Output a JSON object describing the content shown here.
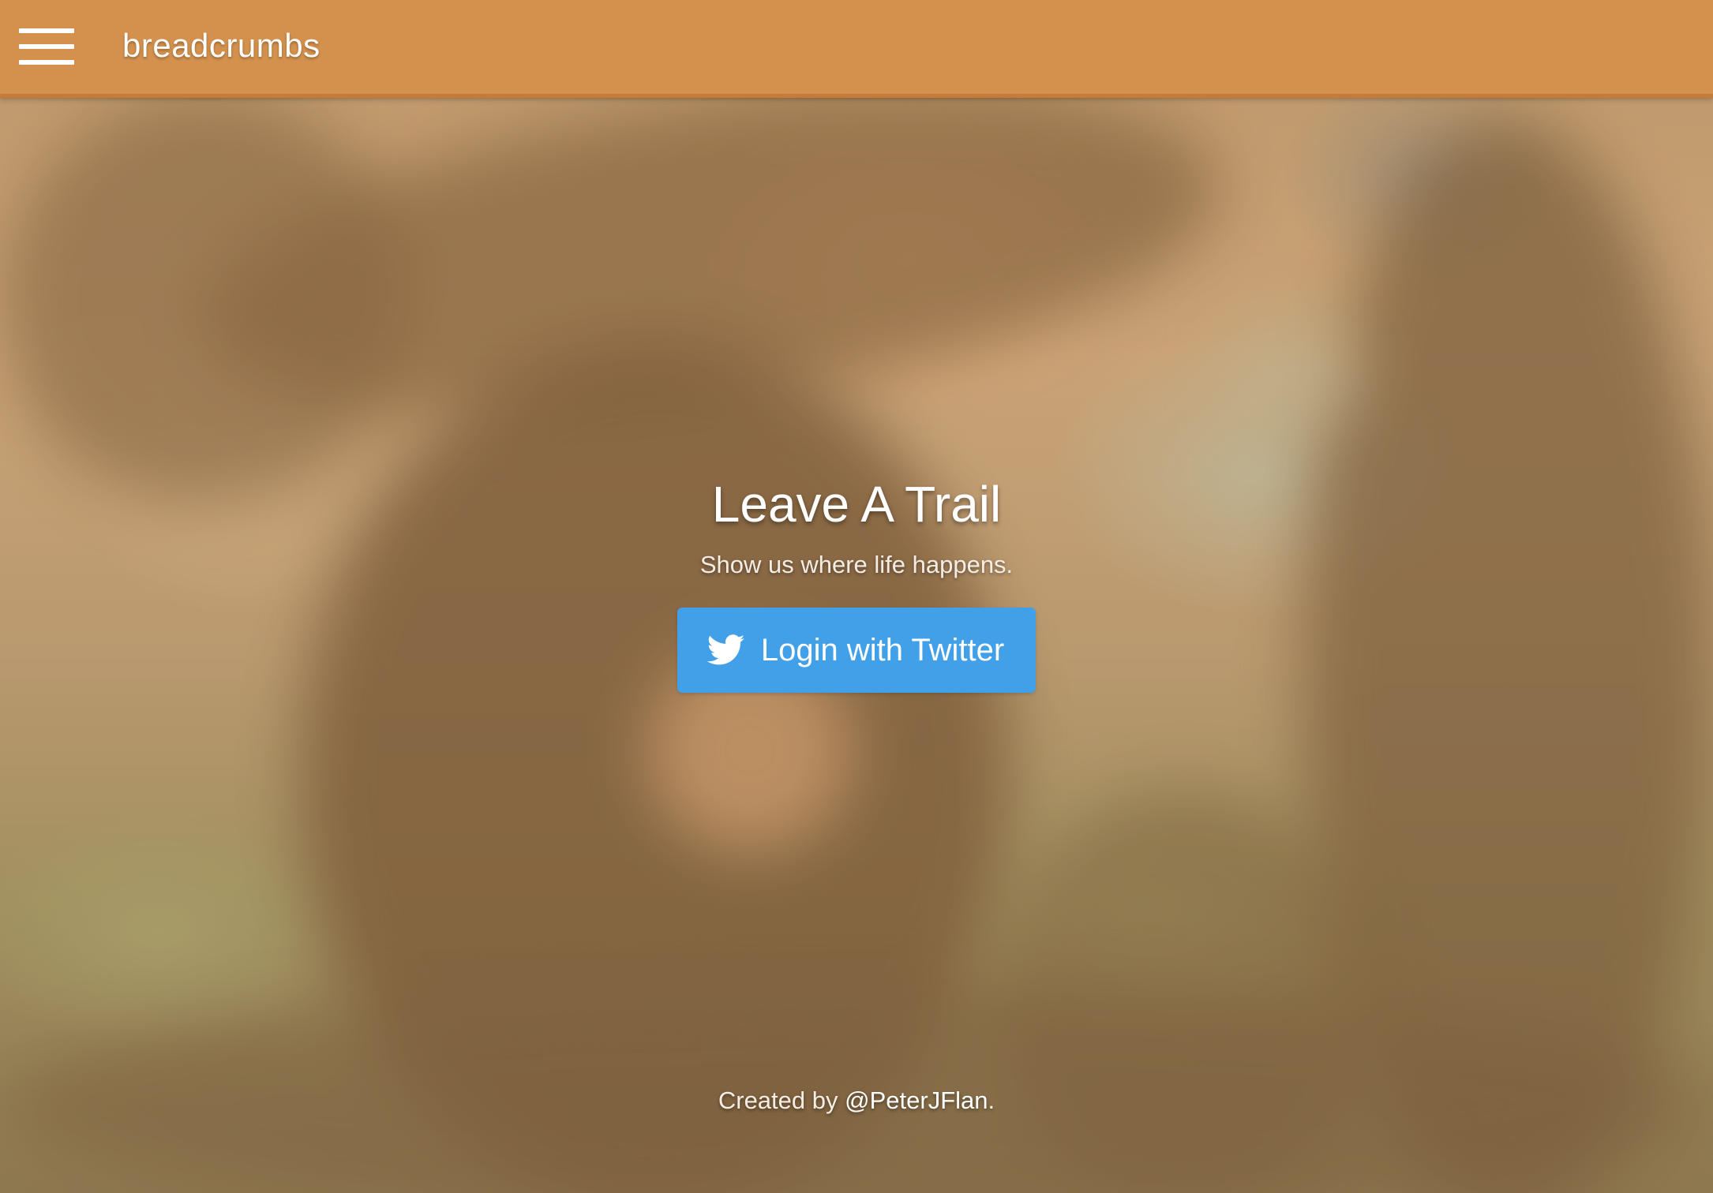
{
  "header": {
    "brand": "breadcrumbs",
    "menu_icon": "hamburger-menu-icon",
    "background_color": "#d4914d"
  },
  "hero": {
    "title": "Leave A Trail",
    "subtitle": "Show us where life happens.",
    "login_button": {
      "label": "Login with Twitter",
      "icon": "twitter-bird-icon",
      "color": "#42a0e9"
    }
  },
  "footer": {
    "prefix": "Created by",
    "author_link": "@PeterJFlan",
    "suffix": "."
  }
}
